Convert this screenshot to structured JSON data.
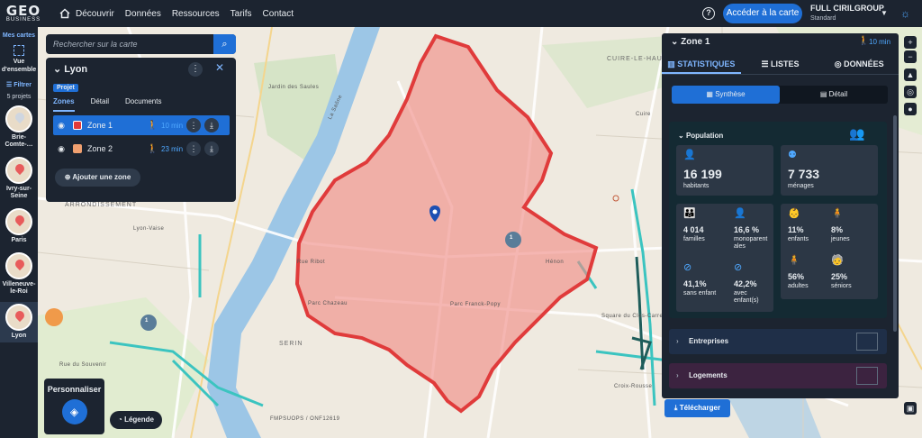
{
  "brand": {
    "logo": "GEO",
    "tagline": "BUSINESS"
  },
  "nav": {
    "items": [
      "Découvrir",
      "Données",
      "Ressources",
      "Tarifs",
      "Contact"
    ]
  },
  "header": {
    "cta": "Accéder à la carte",
    "account_name": "FULL CIRILGROUP",
    "account_plan": "Standard"
  },
  "sidebar": {
    "title": "Mes cartes",
    "overview": "Vue d'ensemble",
    "filter": "Filtrer",
    "count": "5 projets",
    "projects": [
      "Brie-Comte-…",
      "Ivry-sur-Seine",
      "Paris",
      "Villeneuve-le-Roi",
      "Lyon"
    ]
  },
  "search": {
    "placeholder": "Rechercher sur la carte"
  },
  "project_panel": {
    "title": "Lyon",
    "tag": "Projet",
    "tabs": [
      "Zones",
      "Détail",
      "Documents"
    ],
    "zones": [
      {
        "name": "Zone 1",
        "time": "10 min",
        "color": "#e03b3b"
      },
      {
        "name": "Zone 2",
        "time": "23 min",
        "color": "#f0a070"
      }
    ],
    "add_zone": "Ajouter une zone"
  },
  "right_panel": {
    "title": "Zone 1",
    "time": "10 min",
    "tabs": [
      "STATISTIQUES",
      "LISTES",
      "DONNÉES"
    ],
    "segments": [
      "Synthèse",
      "Détail"
    ],
    "population": {
      "title": "Population",
      "inhabitants_value": "16 199",
      "inhabitants_label": "habitants",
      "households_value": "7 733",
      "households_label": "ménages",
      "families_value": "4 014",
      "families_label": "familles",
      "single_parent_value": "16,6 %",
      "single_parent_label": "monoparentales",
      "children_value": "11%",
      "children_label": "enfants",
      "youth_value": "8%",
      "youth_label": "jeunes",
      "no_child_value": "41,1%",
      "no_child_label": "sans enfant",
      "with_child_value": "42,2%",
      "with_child_label": "avec enfant(s)",
      "adults_value": "56%",
      "adults_label": "adultes",
      "seniors_value": "25%",
      "seniors_label": "séniors"
    },
    "sections": [
      "Entreprises",
      "Logements"
    ],
    "download": "Télécharger"
  },
  "map": {
    "labels": [
      "Jardin des Saules",
      "La Saône",
      "ARRONDISSEMENT",
      "Lyon-Vaise",
      "Rue Ribot",
      "Parc Chazeau",
      "Parc Franck-Popy",
      "Hénon",
      "Square du Clos-Carret",
      "Croix-Rousse",
      "SERIN",
      "Rue du Souvenir",
      "CUIRE-LE-HAUT",
      "Cuire"
    ],
    "markers": [
      "1",
      "1"
    ],
    "attribution": "FMPSUOPS / ONF12619"
  },
  "bottom": {
    "customize": "Personnaliser",
    "legend": "Légende"
  },
  "colors": {
    "accent": "#1f6fd6",
    "panel": "#1c2430",
    "zone": "#e03b3b"
  }
}
